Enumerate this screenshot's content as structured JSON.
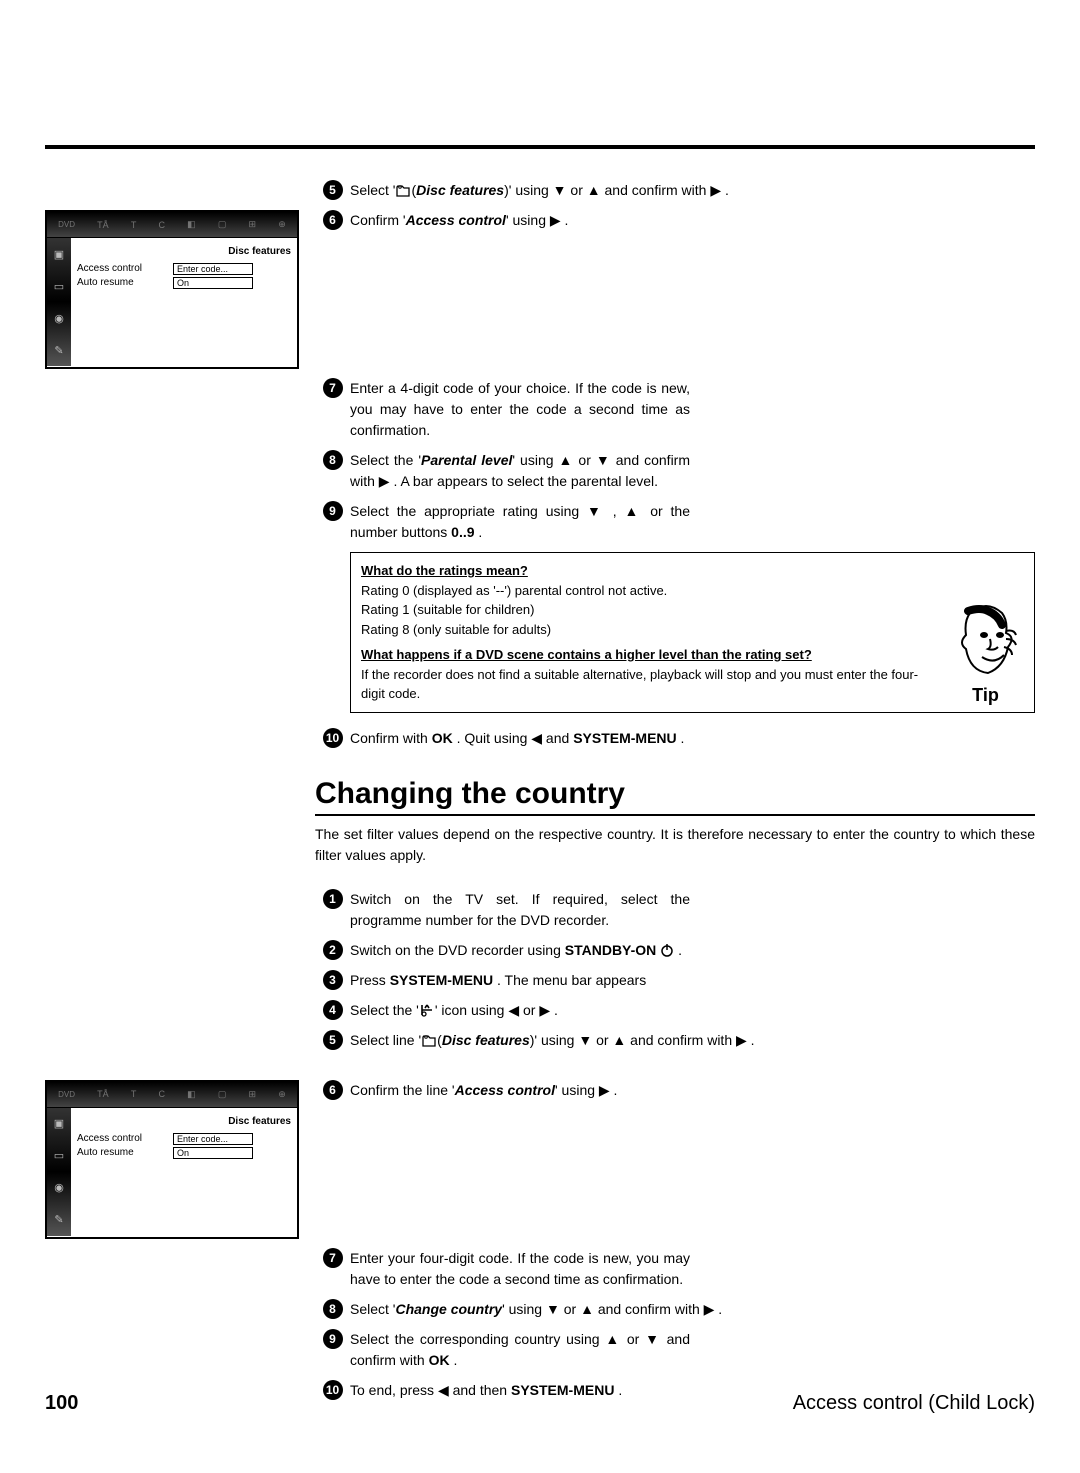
{
  "steps_a": {
    "s5": {
      "prefix": "Select '",
      "feat": "Disc features",
      "suffix": ")' using  ▼  or  ▲  and confirm with  ▶ ."
    },
    "s6": {
      "prefix": "Confirm '",
      "feat": "Access control",
      "suffix": "' using  ▶ ."
    },
    "s7": "Enter a 4-digit code of your choice. If the code is new, you may have to enter the code a second time as confirmation.",
    "s8": {
      "prefix": "Select the '",
      "feat": "Parental level",
      "suffix": "' using  ▲  or  ▼  and confirm with  ▶ . A bar appears to select the parental level."
    },
    "s9": {
      "t1": "Select the appropriate rating using  ▼ ,  ▲  or the number buttons ",
      "t2": "0..9",
      "t3": " ."
    },
    "s10": {
      "t1": "Confirm with ",
      "t2": "OK",
      "t3": " . Quit using  ◀  and ",
      "t4": "SYSTEM-MENU",
      "t5": " ."
    }
  },
  "tip": {
    "h1": "What do the ratings mean?",
    "l1": "Rating 0 (displayed as '--') parental control not active.",
    "l2": "Rating 1 (suitable for children)",
    "l3": "Rating 8 (only suitable for adults)",
    "h2": "What happens if a DVD scene contains a higher level than the rating set?",
    "l4": "If the recorder does not find a suitable alternative, playback will stop and you must enter the four-digit code.",
    "caption": "Tip"
  },
  "section2": {
    "title": "Changing the country",
    "intro": "The set filter values depend on the respective country. It is therefore necessary to enter the country to which these filter values apply."
  },
  "steps_b": {
    "s1": "Switch on the TV set. If required, select the programme number for the DVD recorder.",
    "s2": {
      "t1": "Switch on the DVD recorder using ",
      "t2": "STANDBY-ON",
      "t3": " "
    },
    "s3": {
      "t1": "Press ",
      "t2": "SYSTEM-MENU",
      "t3": " . The menu bar appears"
    },
    "s4": {
      "t1": "Select the '",
      "t2": "' icon using  ◀  or  ▶ ."
    },
    "s5": {
      "t1": "Select line '",
      "t2": "Disc features",
      "t3": ")' using  ▼  or  ▲  and confirm with  ▶ ."
    },
    "s6": {
      "t1": "Confirm the line '",
      "t2": "Access control",
      "t3": "' using  ▶ ."
    },
    "s7": "Enter your four-digit code. If the code is new, you may have to enter the code a second time as confirmation.",
    "s8": {
      "t1": "Select '",
      "t2": "Change country",
      "t3": "' using  ▼  or  ▲  and confirm with  ▶ ."
    },
    "s9": {
      "t1": "Select the corresponding country using  ▲  or  ▼  and confirm with ",
      "t2": "OK",
      "t3": " ."
    },
    "s10": {
      "t1": "To end, press  ◀  and then ",
      "t2": "SYSTEM-MENU",
      "t3": " ."
    }
  },
  "osd": {
    "title": "Disc features",
    "rows": [
      {
        "label": "Access control",
        "value": "Enter code..."
      },
      {
        "label": "Auto resume",
        "value": "On"
      }
    ],
    "topicons": [
      "TÅ",
      "T",
      "C",
      "◧",
      "▢",
      "⊞",
      "⊕"
    ],
    "sideicons": [
      "▣",
      "▭",
      "◉",
      "✎"
    ]
  },
  "footer": {
    "page": "100",
    "section": "Access control (Child Lock)"
  }
}
